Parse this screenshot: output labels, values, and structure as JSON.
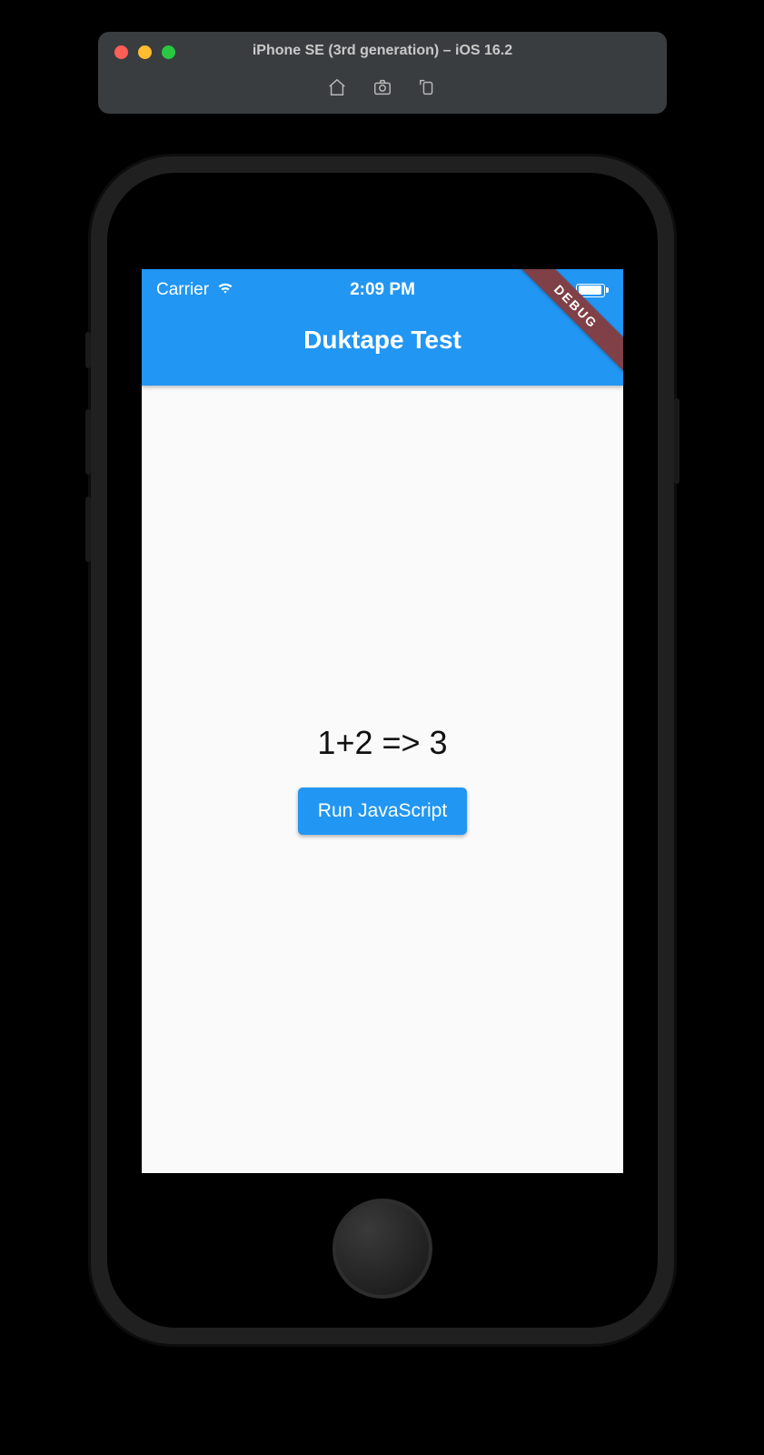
{
  "simulator": {
    "title": "iPhone SE (3rd generation) – iOS 16.2",
    "icons": {
      "home": "home-icon",
      "screenshot": "screenshot-icon",
      "rotate": "rotate-icon"
    }
  },
  "status": {
    "carrier": "Carrier",
    "time": "2:09 PM"
  },
  "app": {
    "title": "Duktape Test",
    "debug_label": "DEBUG",
    "result": "1+2 => 3",
    "button_label": "Run JavaScript"
  },
  "colors": {
    "accent": "#2196f3",
    "background": "#fafafa",
    "chrome": "#3a3d3f",
    "ribbon": "#804048"
  }
}
